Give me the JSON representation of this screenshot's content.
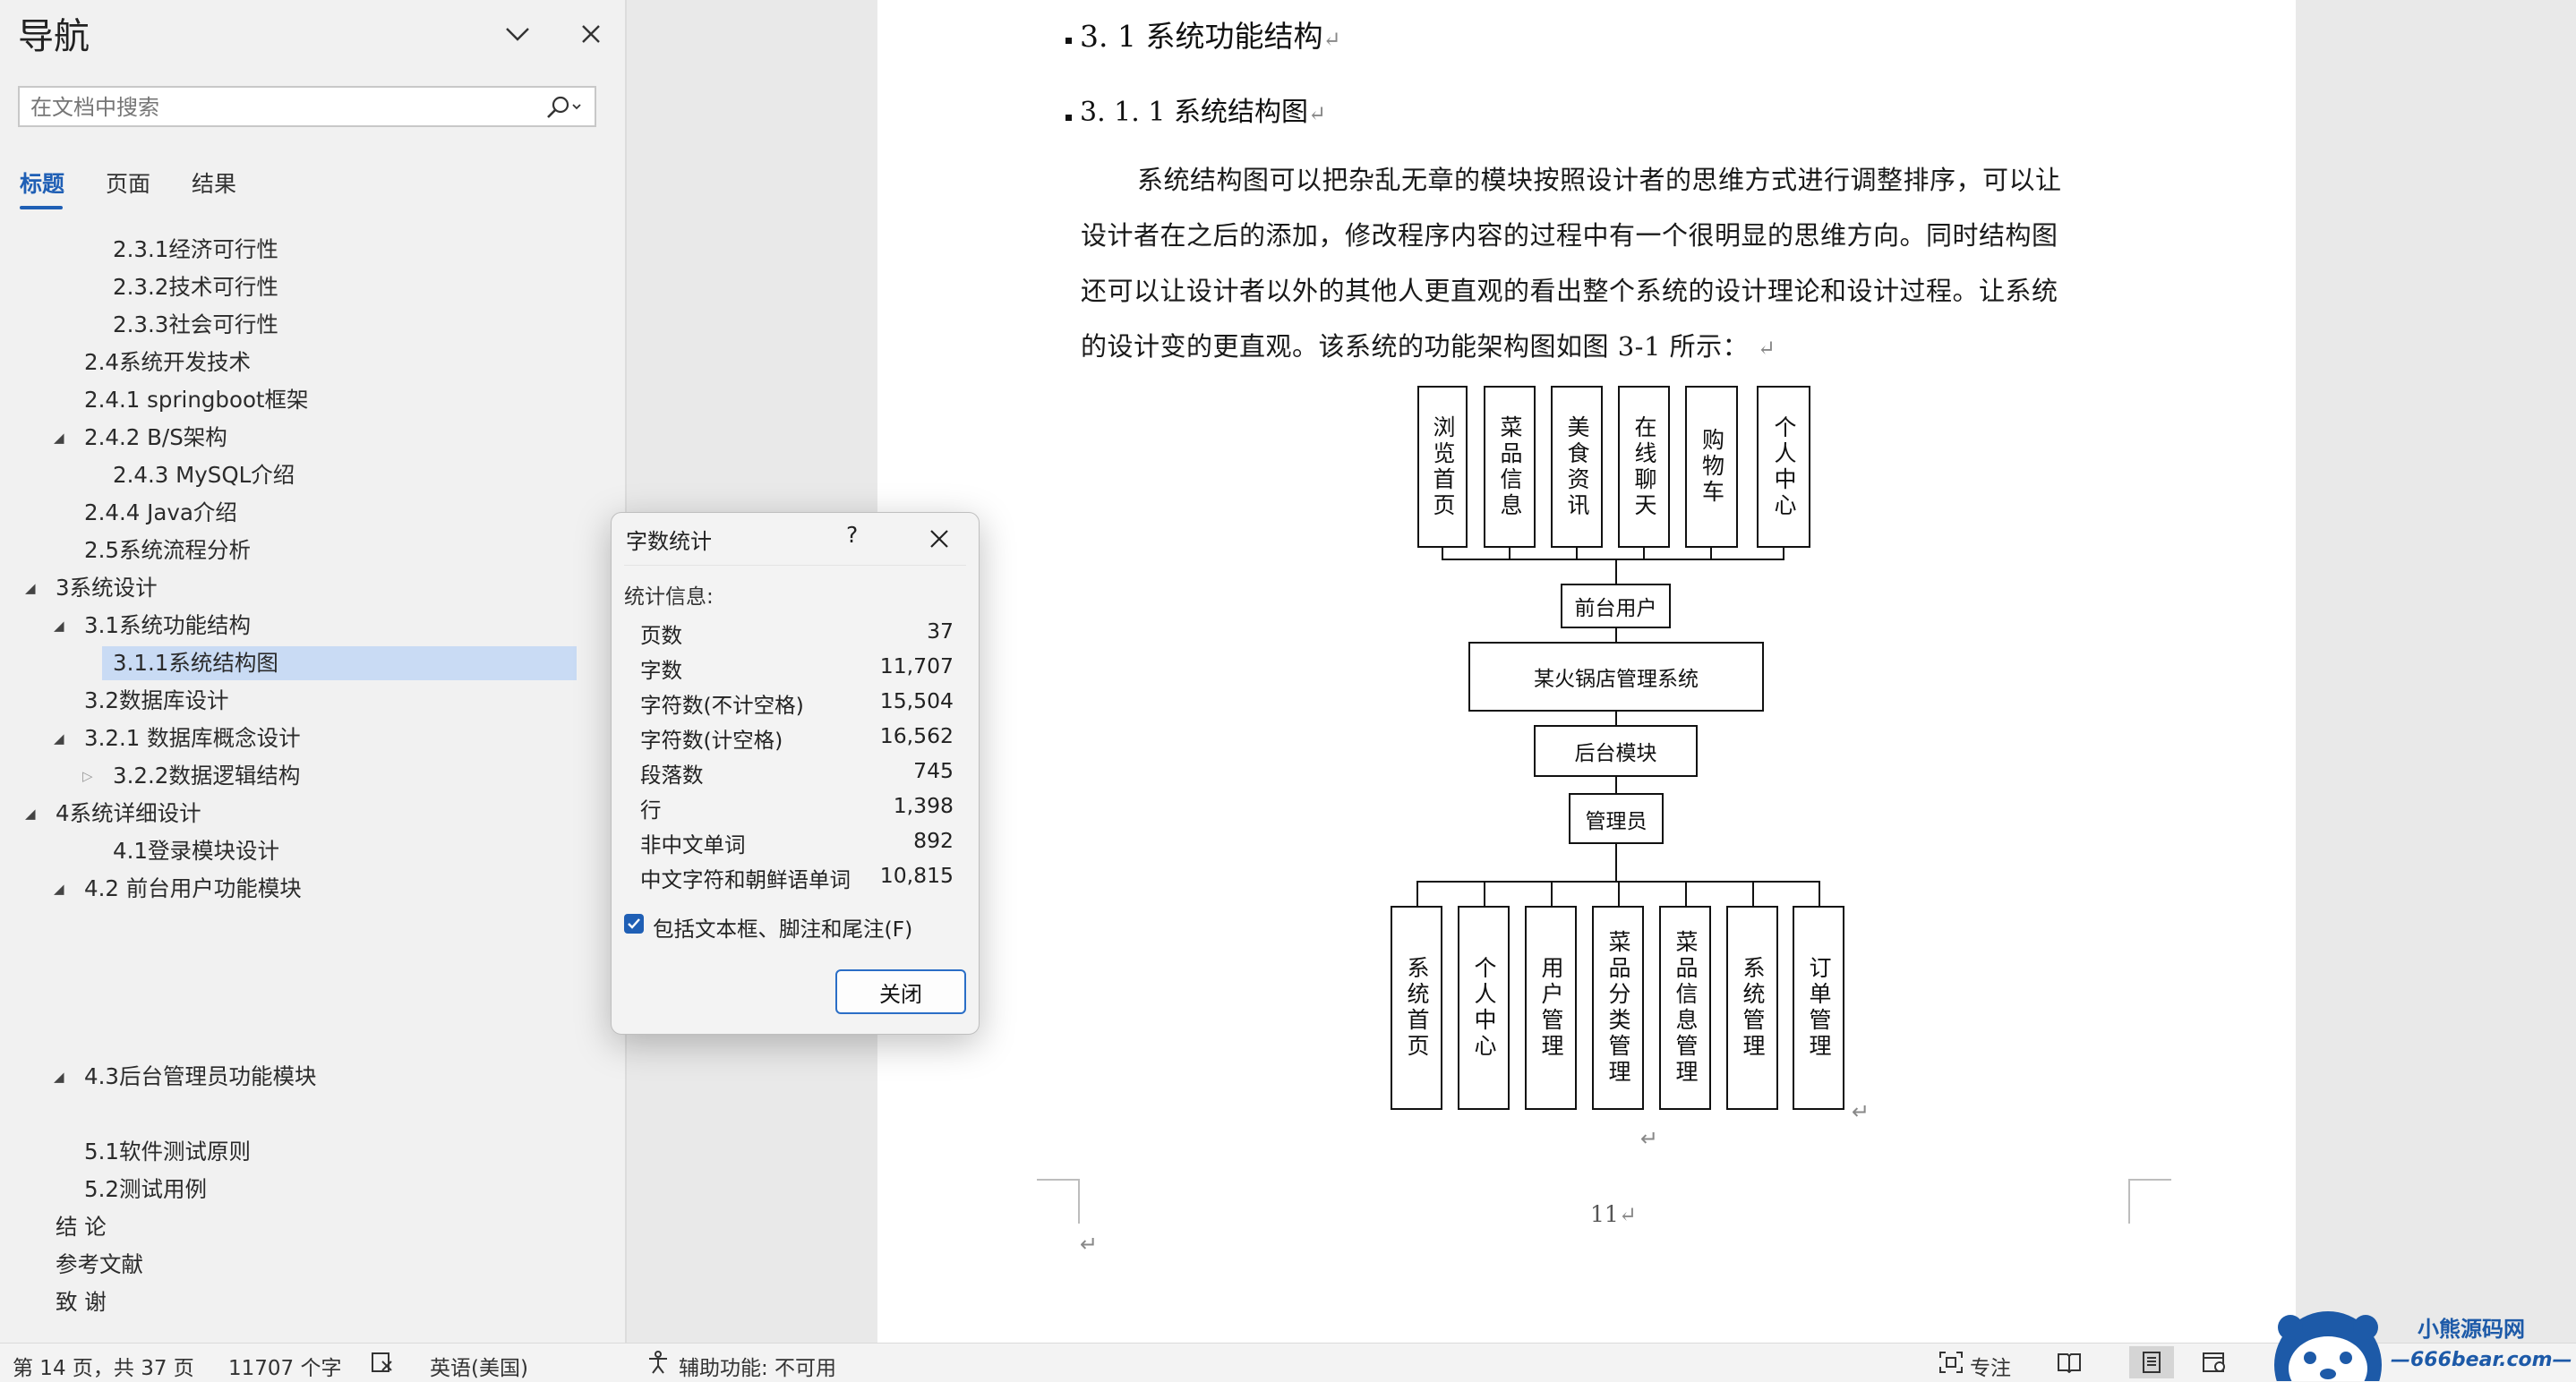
{
  "nav": {
    "title": "导航",
    "search_placeholder": "在文档中搜索",
    "tabs": [
      "标题",
      "页面",
      "结果"
    ],
    "items": [
      {
        "label": "2.3.1经济可行性"
      },
      {
        "label": "2.3.2技术可行性"
      },
      {
        "label": "2.3.3社会可行性"
      },
      {
        "label": "2.4系统开发技术"
      },
      {
        "label": "2.4.1 springboot框架"
      },
      {
        "label": "2.4.2 B/S架构"
      },
      {
        "label": "2.4.3 MySQL介绍"
      },
      {
        "label": "2.4.4 Java介绍"
      },
      {
        "label": "2.5系统流程分析"
      },
      {
        "label": "3系统设计"
      },
      {
        "label": "3.1系统功能结构"
      },
      {
        "label": "3.1.1系统结构图"
      },
      {
        "label": "3.2数据库设计"
      },
      {
        "label": "3.2.1 数据库概念设计"
      },
      {
        "label": "3.2.2数据逻辑结构"
      },
      {
        "label": "4系统详细设计"
      },
      {
        "label": "4.1登录模块设计"
      },
      {
        "label": "4.2 前台用户功能模块"
      },
      {
        "label": "4.3后台管理员功能模块"
      },
      {
        "label": "5.1软件测试原则"
      },
      {
        "label": "5.2测试用例"
      },
      {
        "label": "结  论"
      },
      {
        "label": "参考文献"
      },
      {
        "label": "致  谢"
      }
    ],
    "selected_item": "3.1.1系统结构图"
  },
  "document": {
    "heading_2": "3. 1 系统功能结构",
    "heading_3": "3. 1. 1 系统结构图",
    "paragraph_lines": [
      "系统结构图可以把杂乱无章的模块按照设计者的思维方式进行调整排序，可以让",
      "设计者在之后的添加，修改程序内容的过程中有一个很明显的思维方向。同时结构图",
      "还可以让设计者以外的其他人更直观的看出整个系统的设计理论和设计过程。让系统",
      "的设计变的更直观。该系统的功能架构图如图 3-1 所示："
    ],
    "page_number": "11",
    "return_mark": "↵"
  },
  "diagram": {
    "top_modules": [
      "浏览首页",
      "菜品信息",
      "美食资讯",
      "在线聊天",
      "购物车",
      "个人中心"
    ],
    "front_user": "前台用户",
    "system": "某火锅店管理系统",
    "backend": "后台模块",
    "admin": "管理员",
    "bottom_modules": [
      "系统首页",
      "个人中心",
      "用户管理",
      "菜品分类管理",
      "菜品信息管理",
      "系统管理",
      "订单管理"
    ]
  },
  "dialog": {
    "title": "字数统计",
    "help": "?",
    "stats_label": "统计信息:",
    "stats": [
      {
        "label": "页数",
        "value": "37"
      },
      {
        "label": "字数",
        "value": "11,707"
      },
      {
        "label": "字符数(不计空格)",
        "value": "15,504"
      },
      {
        "label": "字符数(计空格)",
        "value": "16,562"
      },
      {
        "label": "段落数",
        "value": "745"
      },
      {
        "label": "行",
        "value": "1,398"
      },
      {
        "label": "非中文单词",
        "value": "892"
      },
      {
        "label": "中文字符和朝鲜语单词",
        "value": "10,815"
      }
    ],
    "checkbox_label": "包括文本框、脚注和尾注(F)",
    "checkbox_checked": true,
    "close_label": "关闭"
  },
  "status": {
    "page_info": "第 14 页，共 37 页",
    "word_count": "11707 个字",
    "language": "英语(美国)",
    "accessibility": "辅助功能: 不可用",
    "focus": "专注"
  },
  "watermark": {
    "title": "小熊源码网",
    "url": "—666bear.com—"
  },
  "colors": {
    "accent": "#1f5fb5",
    "selection": "#c9dbf4",
    "nav_bg": "#f1f1f1",
    "workspace_bg": "#e9e9e9"
  }
}
